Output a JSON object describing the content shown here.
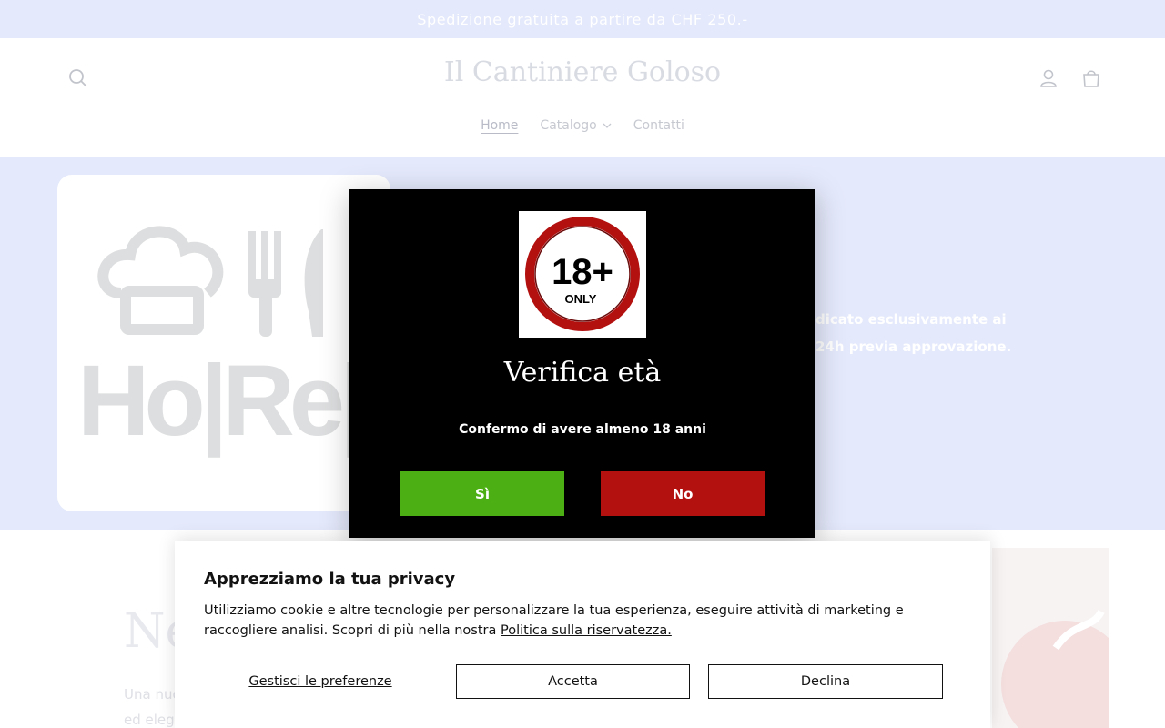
{
  "announcement": {
    "text": "Spedizione gratuita a partire da CHF 250.-"
  },
  "header": {
    "logo": "Il Cantiniere Goloso",
    "nav": [
      {
        "label": "Home"
      },
      {
        "label": "Catalogo"
      },
      {
        "label": "Contatti"
      }
    ],
    "icons": {
      "search": "search-icon",
      "account": "user-icon",
      "cart": "cart-icon",
      "dropdown": "chevron-down-icon"
    }
  },
  "hero": {
    "image_text": "Ho|Re|Ca",
    "text_line1": "dicato esclusivamente ai",
    "text_line2": "24h previa approvazione."
  },
  "below": {
    "title": "Ne",
    "text_line1": "Una nuo",
    "text_line2": "ed elega"
  },
  "age_modal": {
    "badge_number": "18+",
    "badge_label": "ONLY",
    "title": "Verifica età",
    "subtitle": "Confermo di avere almeno 18 anni",
    "yes_label": "Sì",
    "no_label": "No",
    "colors": {
      "yes": "#4caf14",
      "no": "#b31010",
      "badge_ring": "#b31010"
    }
  },
  "cookie_banner": {
    "title": "Apprezziamo la tua privacy",
    "body": "Utilizziamo cookie e altre tecnologie per personalizzare la tua esperienza, eseguire attività di marketing e raccogliere analisi. Scopri di più nella nostra ",
    "link": "Politica sulla riservatezza.",
    "manage_label": "Gestisci le preferenze",
    "accept_label": "Accetta",
    "decline_label": "Declina"
  }
}
